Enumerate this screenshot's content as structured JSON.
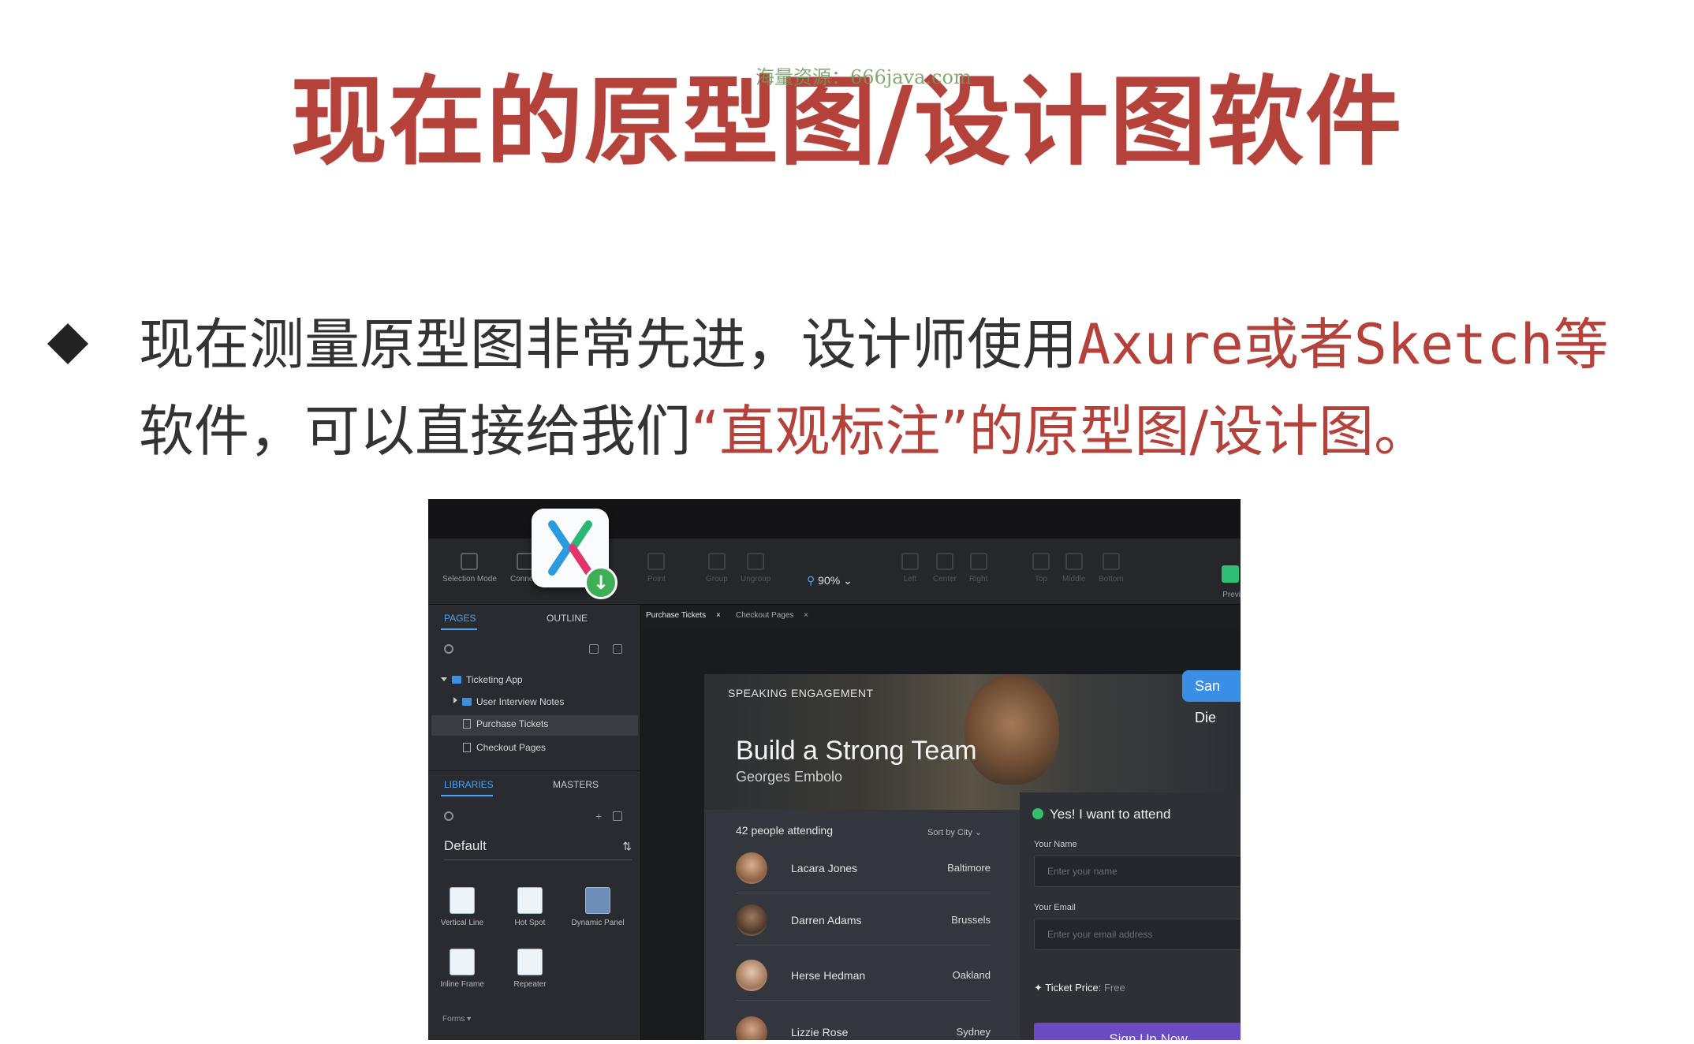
{
  "slide": {
    "title": "现在的原型图/设计图软件",
    "watermark": "海量资源：666java.com",
    "bullet": {
      "line1_a": "现在测量原型图非常先进，设计师使用",
      "line1_b": "Axure或者Sketch等",
      "line2_a": "软件，可以直接给我们",
      "line2_b": "“直观标注”的原型图/设计图。"
    }
  },
  "app": {
    "toolbar": {
      "items": [
        "Selection Mode",
        "Connect",
        "Point",
        "Group",
        "Ungroup",
        "Left",
        "Center",
        "Right",
        "Top",
        "Middle",
        "Bottom"
      ],
      "zoom": "90%",
      "preview": "Previ"
    },
    "left_panel": {
      "pages_tab": "PAGES",
      "outline_tab": "OUTLINE",
      "tree": [
        "Ticketing App",
        "User Interview Notes",
        "Purchase Tickets",
        "Checkout Pages"
      ],
      "libraries_tab": "LIBRARIES",
      "masters_tab": "MASTERS",
      "library_select": "Default",
      "widgets": [
        "Vertical Line",
        "Hot Spot",
        "Dynamic Panel",
        "Inline Frame",
        "Repeater"
      ],
      "forms_label": "Forms ▾"
    },
    "doc_tabs": [
      "Purchase Tickets",
      "Checkout Pages"
    ],
    "hero": {
      "kicker": "SPEAKING ENGAGEMENT",
      "title": "Build a Strong Team",
      "author": "Georges Embolo",
      "badge": "San Die"
    },
    "attendees": {
      "count": "42 people attending",
      "sort": "Sort by City",
      "people": [
        {
          "name": "Lacara Jones",
          "city": "Baltimore"
        },
        {
          "name": "Darren Adams",
          "city": "Brussels"
        },
        {
          "name": "Herse Hedman",
          "city": "Oakland"
        },
        {
          "name": "Lizzie Rose",
          "city": "Sydney"
        }
      ]
    },
    "form": {
      "title": "Yes! I want to attend",
      "name_label": "Your Name",
      "name_placeholder": "Enter your name",
      "email_label": "Your Email",
      "email_placeholder": "Enter your email address",
      "price_label": "Ticket Price:",
      "price_value": "Free",
      "signup": "Sign Up Now"
    }
  },
  "colors": {
    "title": "#b5413b",
    "highlight": "#b5413b",
    "body": "#333333"
  }
}
